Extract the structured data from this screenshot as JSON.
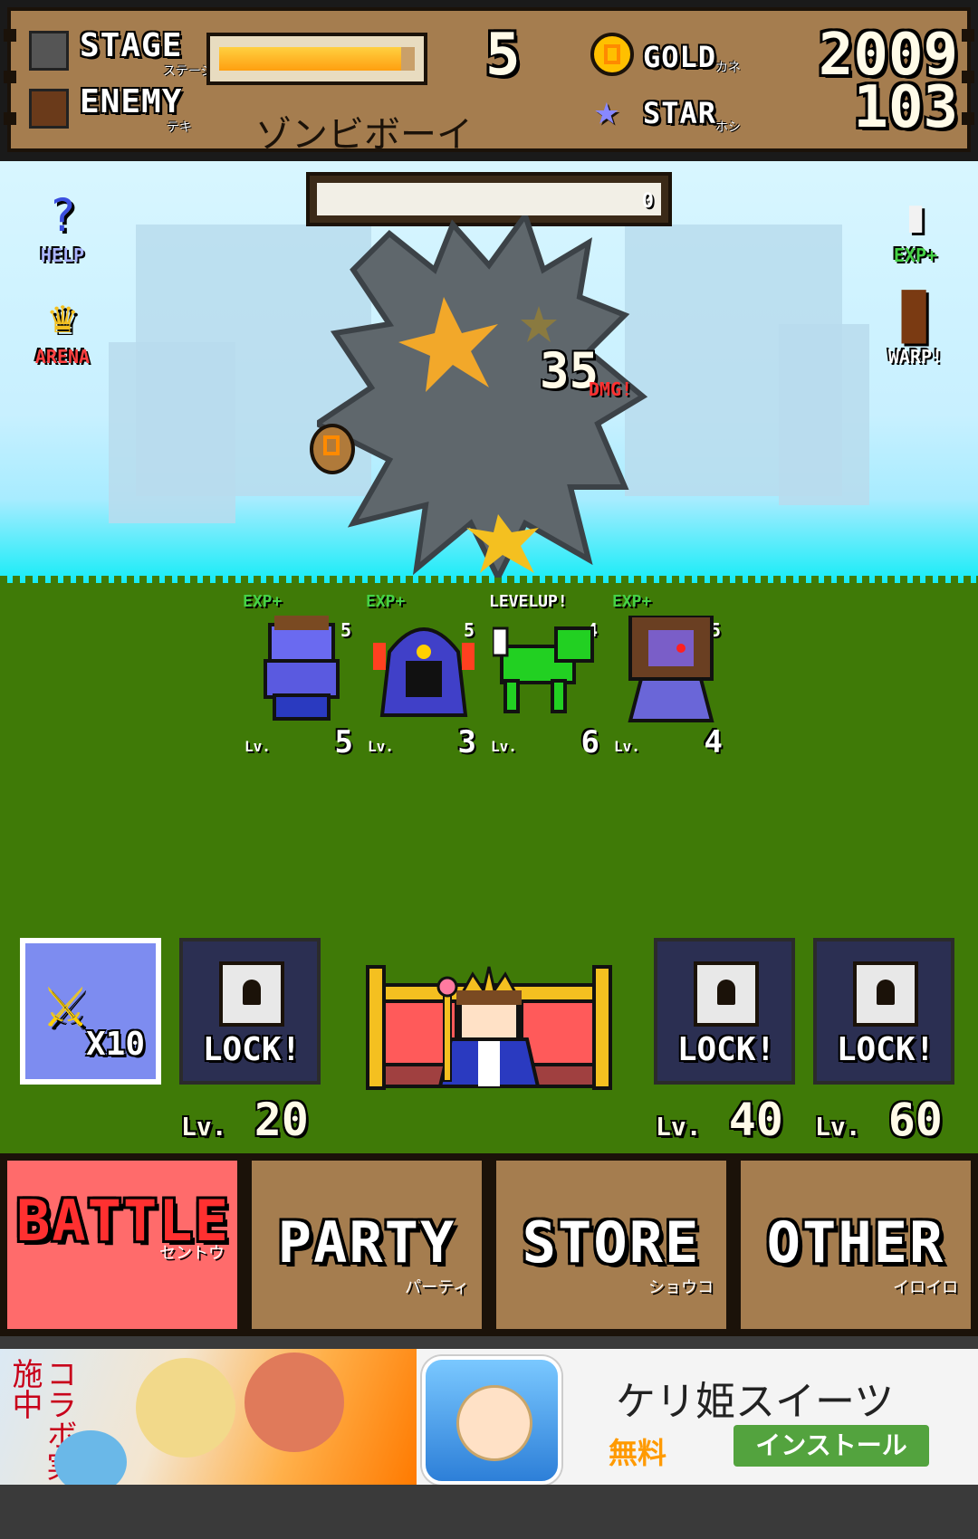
{
  "hud": {
    "stage_label": "STAGE",
    "stage_sub": "ステージ",
    "stage_number": "5",
    "stage_progress": 0.93,
    "enemy_label": "ENEMY",
    "enemy_sub": "テキ",
    "enemy_name": "ゾンビボーイ",
    "gold_label": "GOLD",
    "gold_sub": "カネ",
    "gold_value": "2009",
    "star_label": "STAR",
    "star_sub": "ホシ",
    "star_value": "103"
  },
  "battle": {
    "boss_hp_value": "0",
    "damage_value": "35",
    "damage_tag": "DMG!",
    "side_buttons": {
      "help": "HELP",
      "arena": "ARENA",
      "exp": "EXP+",
      "warp": "WARP!"
    },
    "party": [
      {
        "tag": "EXP+",
        "count": "5",
        "lv_label": "Lv.",
        "level": "5",
        "color": "#6a6af0"
      },
      {
        "tag": "EXP+",
        "count": "5",
        "lv_label": "Lv.",
        "level": "3",
        "color": "#4040c8"
      },
      {
        "tag": "LEVELUP!",
        "count": "4",
        "lv_label": "Lv.",
        "level": "6",
        "color": "#22d022"
      },
      {
        "tag": "EXP+",
        "count": "5",
        "lv_label": "Lv.",
        "level": "4",
        "color": "#7a5ec8"
      }
    ]
  },
  "slots": [
    {
      "state": "active",
      "text": "X10",
      "level_label": "",
      "level": ""
    },
    {
      "state": "locked",
      "text": "LOCK!",
      "level_label": "Lv.",
      "level": "20"
    },
    {
      "state": "locked",
      "text": "LOCK!",
      "level_label": "Lv.",
      "level": "40"
    },
    {
      "state": "locked",
      "text": "LOCK!",
      "level_label": "Lv.",
      "level": "60"
    }
  ],
  "tabs": [
    {
      "label": "BATTLE",
      "sub": "セントウ",
      "selected": true
    },
    {
      "label": "PARTY",
      "sub": "パーティ",
      "selected": false
    },
    {
      "label": "STORE",
      "sub": "ショウコ",
      "selected": false
    },
    {
      "label": "OTHER",
      "sub": "イロイロ",
      "selected": false
    }
  ],
  "ad": {
    "banner_text": "コラボ実施中",
    "title": "ケリ姫スイーツ",
    "price": "無料",
    "install": "インストール"
  },
  "colors": {
    "hud_brown": "#a57d4f",
    "grass": "#3f7a07",
    "battle_tab": "#ff6b6b",
    "install_green": "#53a33e"
  }
}
